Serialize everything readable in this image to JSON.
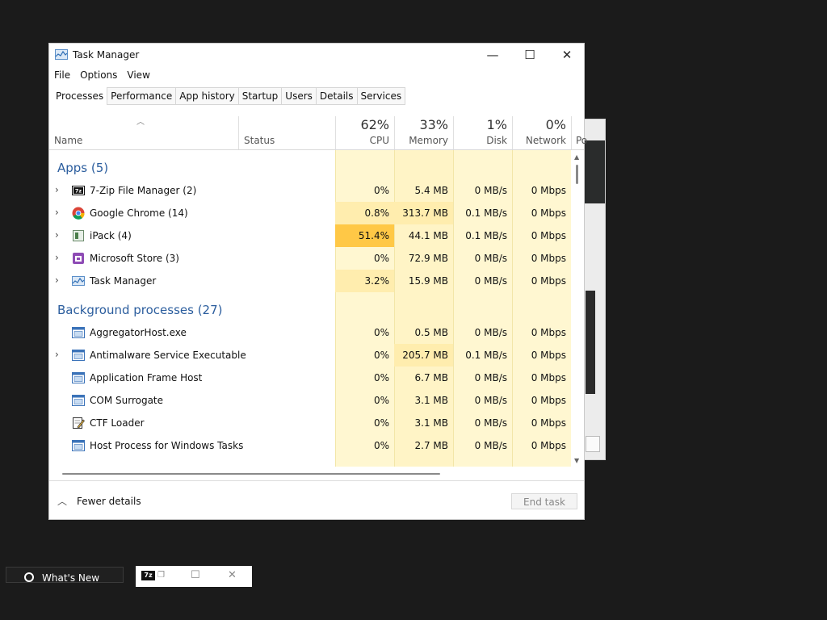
{
  "window": {
    "title": "Task Manager",
    "controls": {
      "minimize": "—",
      "maximize": "☐",
      "close": "✕"
    }
  },
  "menu": [
    "File",
    "Options",
    "View"
  ],
  "tabs": [
    "Processes",
    "Performance",
    "App history",
    "Startup",
    "Users",
    "Details",
    "Services"
  ],
  "columns": {
    "name": "Name",
    "status": "Status",
    "cpu": {
      "pct": "62%",
      "label": "CPU"
    },
    "memory": {
      "pct": "33%",
      "label": "Memory"
    },
    "disk": {
      "pct": "1%",
      "label": "Disk"
    },
    "network": {
      "pct": "0%",
      "label": "Network"
    },
    "power": "Po"
  },
  "groups": {
    "apps": "Apps (5)",
    "background": "Background processes (27)"
  },
  "apps": [
    {
      "name": "7-Zip File Manager (2)",
      "cpu": "0%",
      "memory": "5.4 MB",
      "disk": "0 MB/s",
      "network": "0 Mbps",
      "icon": "7zip-icon"
    },
    {
      "name": "Google Chrome (14)",
      "cpu": "0.8%",
      "memory": "313.7 MB",
      "disk": "0.1 MB/s",
      "network": "0 Mbps",
      "icon": "chrome-icon"
    },
    {
      "name": "iPack (4)",
      "cpu": "51.4%",
      "memory": "44.1 MB",
      "disk": "0.1 MB/s",
      "network": "0 Mbps",
      "icon": "ipack-icon"
    },
    {
      "name": "Microsoft Store (3)",
      "cpu": "0%",
      "memory": "72.9 MB",
      "disk": "0 MB/s",
      "network": "0 Mbps",
      "icon": "store-icon"
    },
    {
      "name": "Task Manager",
      "cpu": "3.2%",
      "memory": "15.9 MB",
      "disk": "0 MB/s",
      "network": "0 Mbps",
      "icon": "taskmanager-icon"
    }
  ],
  "background": [
    {
      "name": "AggregatorHost.exe",
      "cpu": "0%",
      "memory": "0.5 MB",
      "disk": "0 MB/s",
      "network": "0 Mbps"
    },
    {
      "name": "Antimalware Service Executable",
      "cpu": "0%",
      "memory": "205.7 MB",
      "disk": "0.1 MB/s",
      "network": "0 Mbps"
    },
    {
      "name": "Application Frame Host",
      "cpu": "0%",
      "memory": "6.7 MB",
      "disk": "0 MB/s",
      "network": "0 Mbps"
    },
    {
      "name": "COM Surrogate",
      "cpu": "0%",
      "memory": "3.1 MB",
      "disk": "0 MB/s",
      "network": "0 Mbps"
    },
    {
      "name": "CTF Loader",
      "cpu": "0%",
      "memory": "3.1 MB",
      "disk": "0 MB/s",
      "network": "0 Mbps"
    },
    {
      "name": "Host Process for Windows Tasks",
      "cpu": "0%",
      "memory": "2.7 MB",
      "disk": "0 MB/s",
      "network": "0 Mbps"
    }
  ],
  "footer": {
    "fewer_details": "Fewer details",
    "end_task": "End task"
  },
  "taskbar": {
    "whats_new": "What's New",
    "zip_badge": "7z"
  },
  "colors": {
    "heat_low": "#fff7d1",
    "heat_mid": "#ffedae",
    "heat_high": "#ffc846",
    "group_text": "#2c5e9e"
  }
}
